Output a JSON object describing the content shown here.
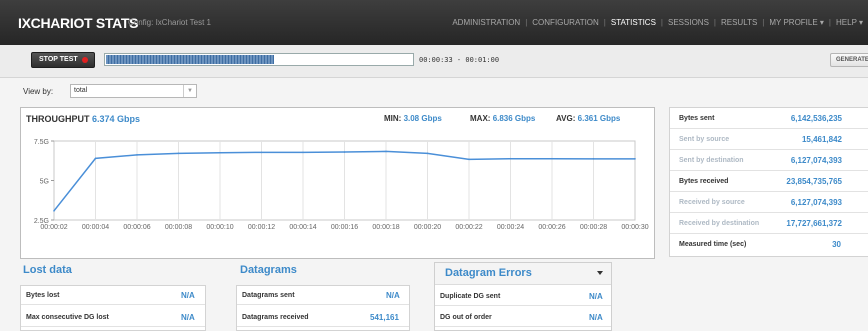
{
  "header": {
    "brand": "IXCHARIOT STATS",
    "config": "Config: IxChariot Test 1",
    "nav": [
      {
        "label": "ADMINISTRATION",
        "active": false
      },
      {
        "label": "CONFIGURATION",
        "active": false
      },
      {
        "label": "STATISTICS",
        "active": true
      },
      {
        "label": "SESSIONS",
        "active": false
      },
      {
        "label": "RESULTS",
        "active": false
      },
      {
        "label": "MY PROFILE ▾",
        "active": false
      },
      {
        "label": "HELP ▾",
        "active": false
      }
    ]
  },
  "toolbar": {
    "stop_label": "STOP TEST",
    "progress_fraction": 0.55,
    "timer": "00:00:33 - 00:01:00",
    "report_label": "GENERATE REPORT"
  },
  "view": {
    "label": "View by:",
    "selected": "total"
  },
  "throughput": {
    "title": "THROUGHPUT",
    "current": "6.374 Gbps",
    "min_label": "MIN:",
    "min": "3.08 Gbps",
    "max_label": "MAX:",
    "max": "6.836 Gbps",
    "avg_label": "AVG:",
    "avg": "6.361 Gbps"
  },
  "chart_data": {
    "type": "line",
    "title": "",
    "xlabel": "",
    "ylabel": "",
    "ylim": [
      2.5,
      7.5
    ],
    "yticks": [
      {
        "value": 2.5,
        "label": "2.5G"
      },
      {
        "value": 5,
        "label": "5G"
      },
      {
        "value": 7.5,
        "label": "7.5G"
      }
    ],
    "x": [
      "00:00:02",
      "00:00:04",
      "00:00:06",
      "00:00:08",
      "00:00:10",
      "00:00:12",
      "00:00:14",
      "00:00:16",
      "00:00:18",
      "00:00:20",
      "00:00:22",
      "00:00:24",
      "00:00:26",
      "00:00:28",
      "00:00:30"
    ],
    "series": [
      {
        "values": [
          3.08,
          6.4,
          6.62,
          6.72,
          6.76,
          6.78,
          6.78,
          6.8,
          6.84,
          6.72,
          6.34,
          6.38,
          6.38,
          6.37,
          6.37
        ]
      }
    ],
    "grid": "vertical",
    "line_color": "#4a8fd8"
  },
  "summary": {
    "rows": [
      {
        "label": "Bytes sent",
        "value": "6,142,536,235",
        "sub": false
      },
      {
        "label": "Sent by source",
        "value": "15,461,842",
        "sub": true
      },
      {
        "label": "Sent by destination",
        "value": "6,127,074,393",
        "sub": true
      },
      {
        "label": "Bytes received",
        "value": "23,854,735,765",
        "sub": false
      },
      {
        "label": "Received by source",
        "value": "6,127,074,393",
        "sub": true
      },
      {
        "label": "Received by destination",
        "value": "17,727,661,372",
        "sub": true
      },
      {
        "label": "Measured time (sec)",
        "value": "30",
        "sub": false
      }
    ]
  },
  "lost_data": {
    "title": "Lost data",
    "rows": [
      {
        "label": "Bytes lost",
        "value": "N/A"
      },
      {
        "label": "Max consecutive DG lost",
        "value": "N/A"
      }
    ]
  },
  "datagrams": {
    "title": "Datagrams",
    "rows": [
      {
        "label": "Datagrams sent",
        "value": "N/A"
      },
      {
        "label": "Datagrams received",
        "value": "541,161"
      }
    ]
  },
  "dg_errors": {
    "title": "Datagram Errors",
    "rows": [
      {
        "label": "Duplicate DG sent",
        "value": "N/A"
      },
      {
        "label": "DG out of order",
        "value": "N/A"
      }
    ]
  },
  "colors": {
    "accent": "#3d8ac9",
    "topbar": "#2e2e2e",
    "stop_dot": "#e02020"
  }
}
